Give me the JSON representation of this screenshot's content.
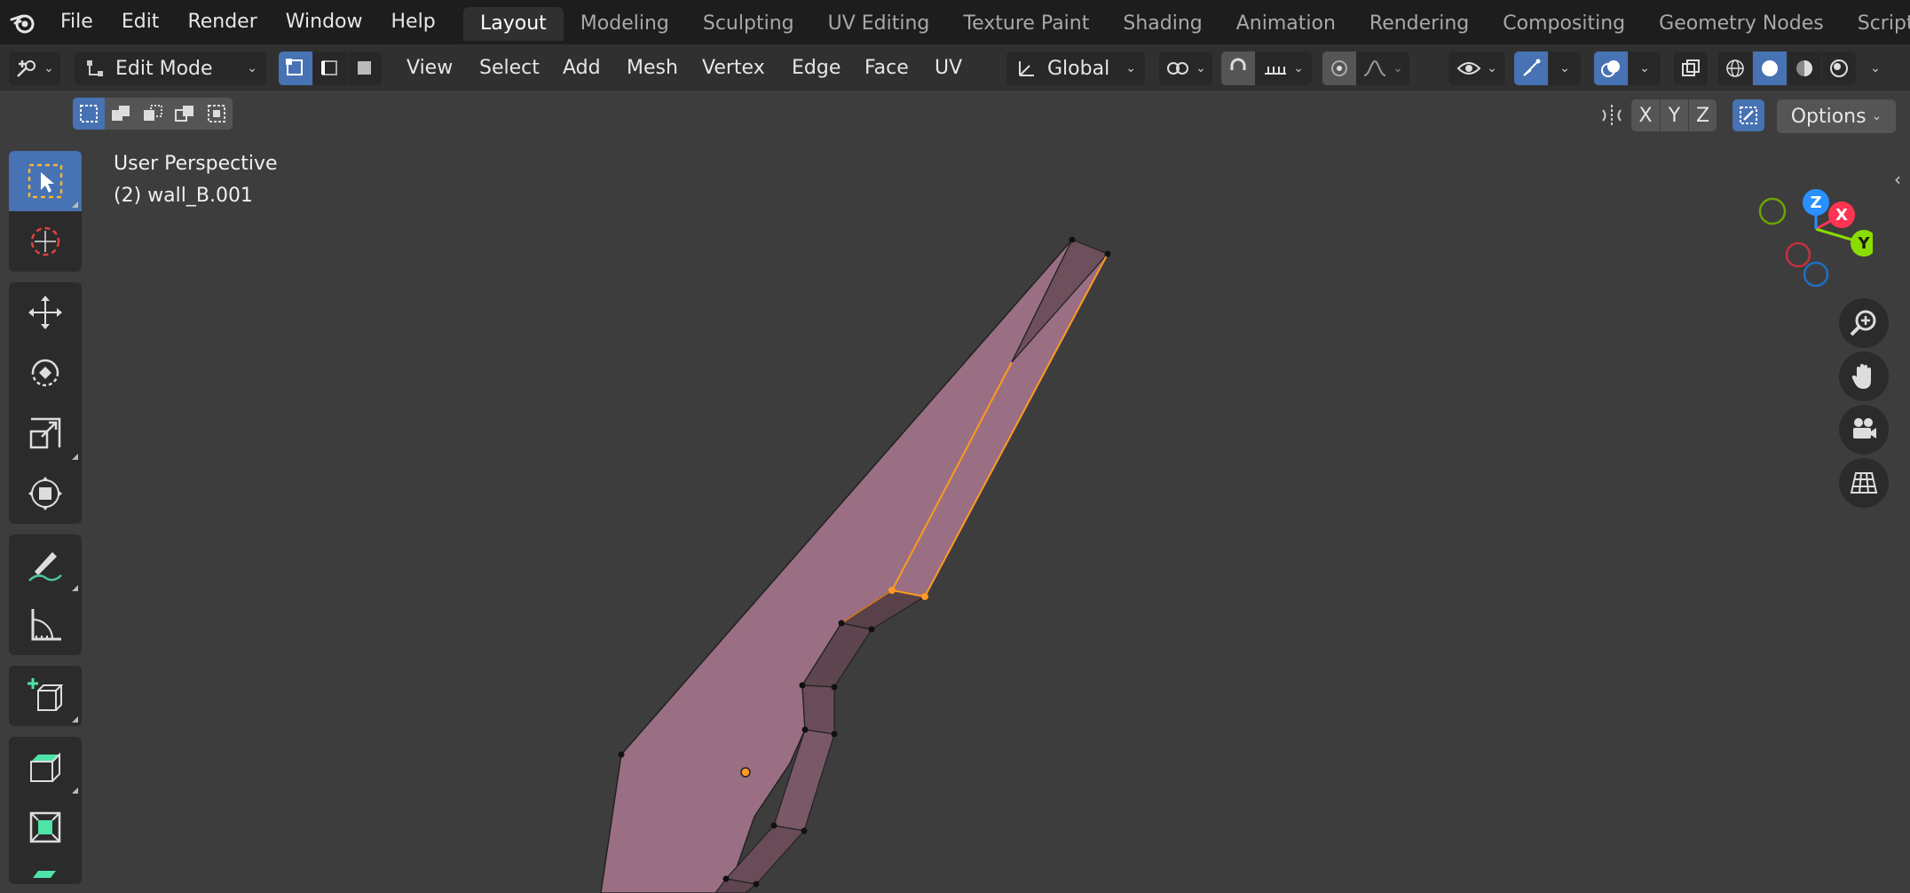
{
  "menubar": {
    "items": [
      "File",
      "Edit",
      "Render",
      "Window",
      "Help"
    ]
  },
  "workspaces": {
    "tabs": [
      "Layout",
      "Modeling",
      "Sculpting",
      "UV Editing",
      "Texture Paint",
      "Shading",
      "Animation",
      "Rendering",
      "Compositing",
      "Geometry Nodes",
      "Scripting"
    ],
    "active": "Layout"
  },
  "header": {
    "mode": "Edit Mode",
    "menus": [
      "View",
      "Select",
      "Add",
      "Mesh",
      "Vertex",
      "Edge",
      "Face",
      "UV"
    ],
    "transform_orientation": "Global"
  },
  "viewport": {
    "perspective_label": "User Perspective",
    "object_label": "(2) wall_B.001",
    "axis_x": "X",
    "axis_y": "Y",
    "axis_z": "Z",
    "mirror_x": "X",
    "mirror_y": "Y",
    "mirror_z": "Z",
    "options_label": "Options"
  },
  "colors": {
    "accent": "#4772b3",
    "mesh_face": "#9a6f83",
    "selection": "#ff9a22",
    "gizmo_x": "#ff3352",
    "gizmo_y": "#8bdc00",
    "gizmo_z": "#2890ff"
  }
}
